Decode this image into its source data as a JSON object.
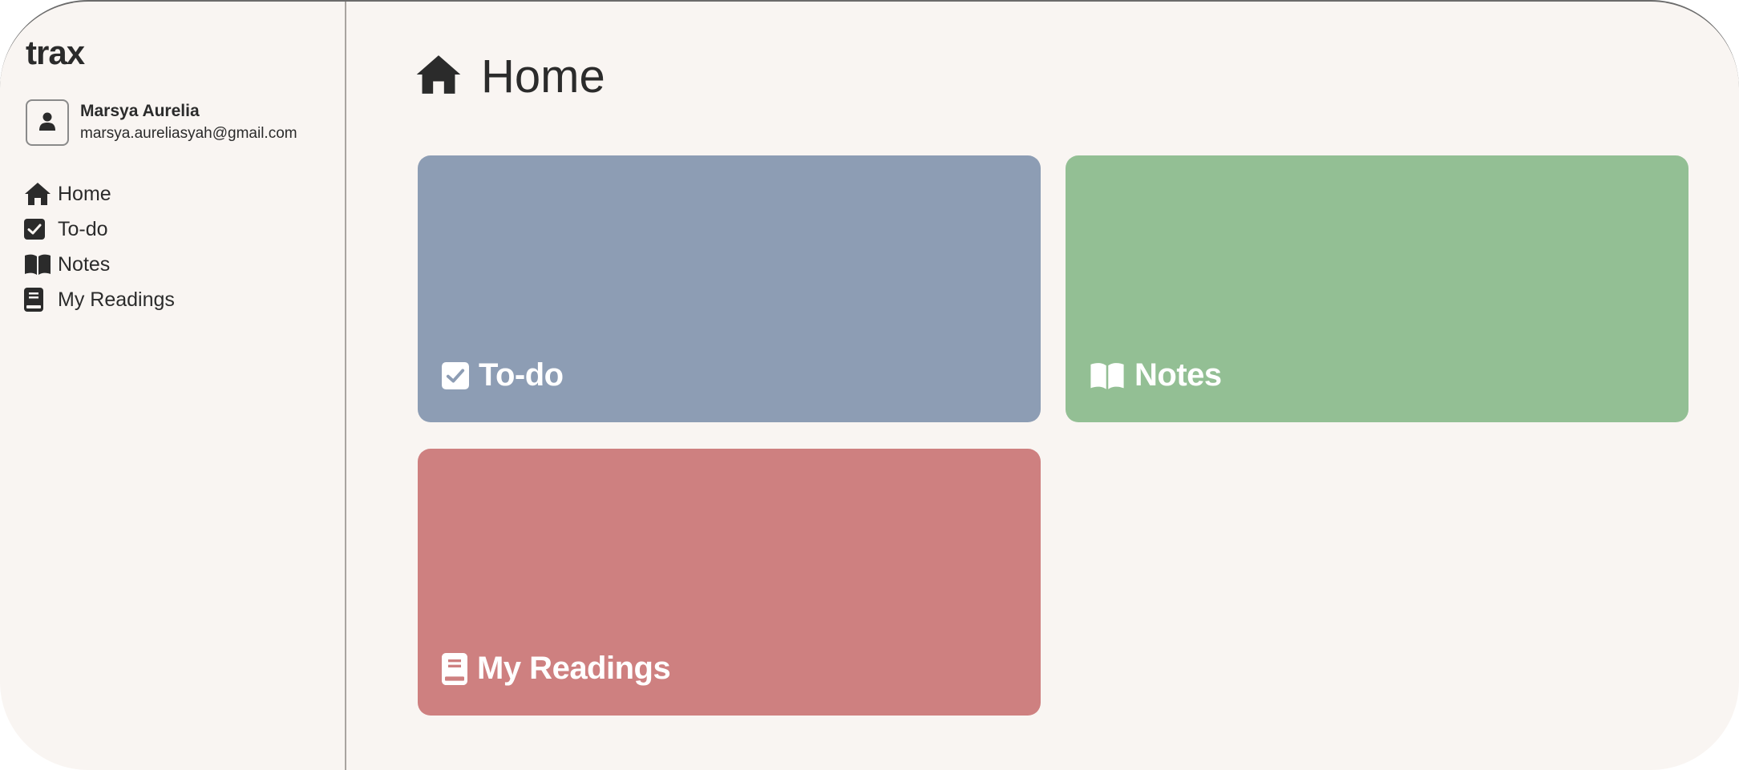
{
  "app": {
    "logo": "trax"
  },
  "user": {
    "name": "Marsya Aurelia",
    "email": "marsya.aureliasyah@gmail.com",
    "avatar_icon": "person-icon"
  },
  "sidebar": {
    "items": [
      {
        "label": "Home",
        "icon": "home-icon"
      },
      {
        "label": "To-do",
        "icon": "checkbox-icon"
      },
      {
        "label": "Notes",
        "icon": "open-book-icon"
      },
      {
        "label": "My Readings",
        "icon": "book-icon"
      }
    ]
  },
  "page": {
    "title": "Home",
    "icon": "home-icon"
  },
  "cards": [
    {
      "label": "To-do",
      "icon": "checkbox-icon",
      "color": "#8d9db4"
    },
    {
      "label": "Notes",
      "icon": "open-book-icon",
      "color": "#93bf94"
    },
    {
      "label": "My Readings",
      "icon": "book-icon",
      "color": "#ce8080"
    }
  ],
  "colors": {
    "background": "#f9f5f2",
    "text": "#2b2b2b",
    "divider": "#a9a4a0"
  }
}
